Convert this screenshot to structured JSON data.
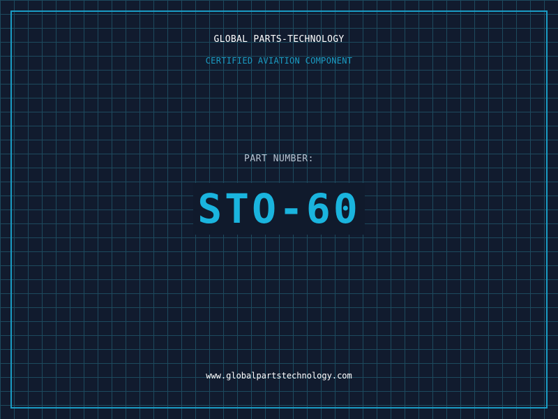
{
  "header": {
    "brand": "GLOBAL PARTS-TECHNOLOGY",
    "tagline": "CERTIFIED AVIATION COMPONENT"
  },
  "part": {
    "label": "PART NUMBER:",
    "number": "STO-60"
  },
  "footer": {
    "website": "www.globalpartstechnology.com"
  },
  "colors": {
    "background": "#111b2e",
    "grid": "#1d4a5e",
    "accent": "#1a9cc4",
    "part_number": "#1ab4de",
    "text_primary": "#ffffff",
    "text_secondary": "#b8c4d2"
  }
}
